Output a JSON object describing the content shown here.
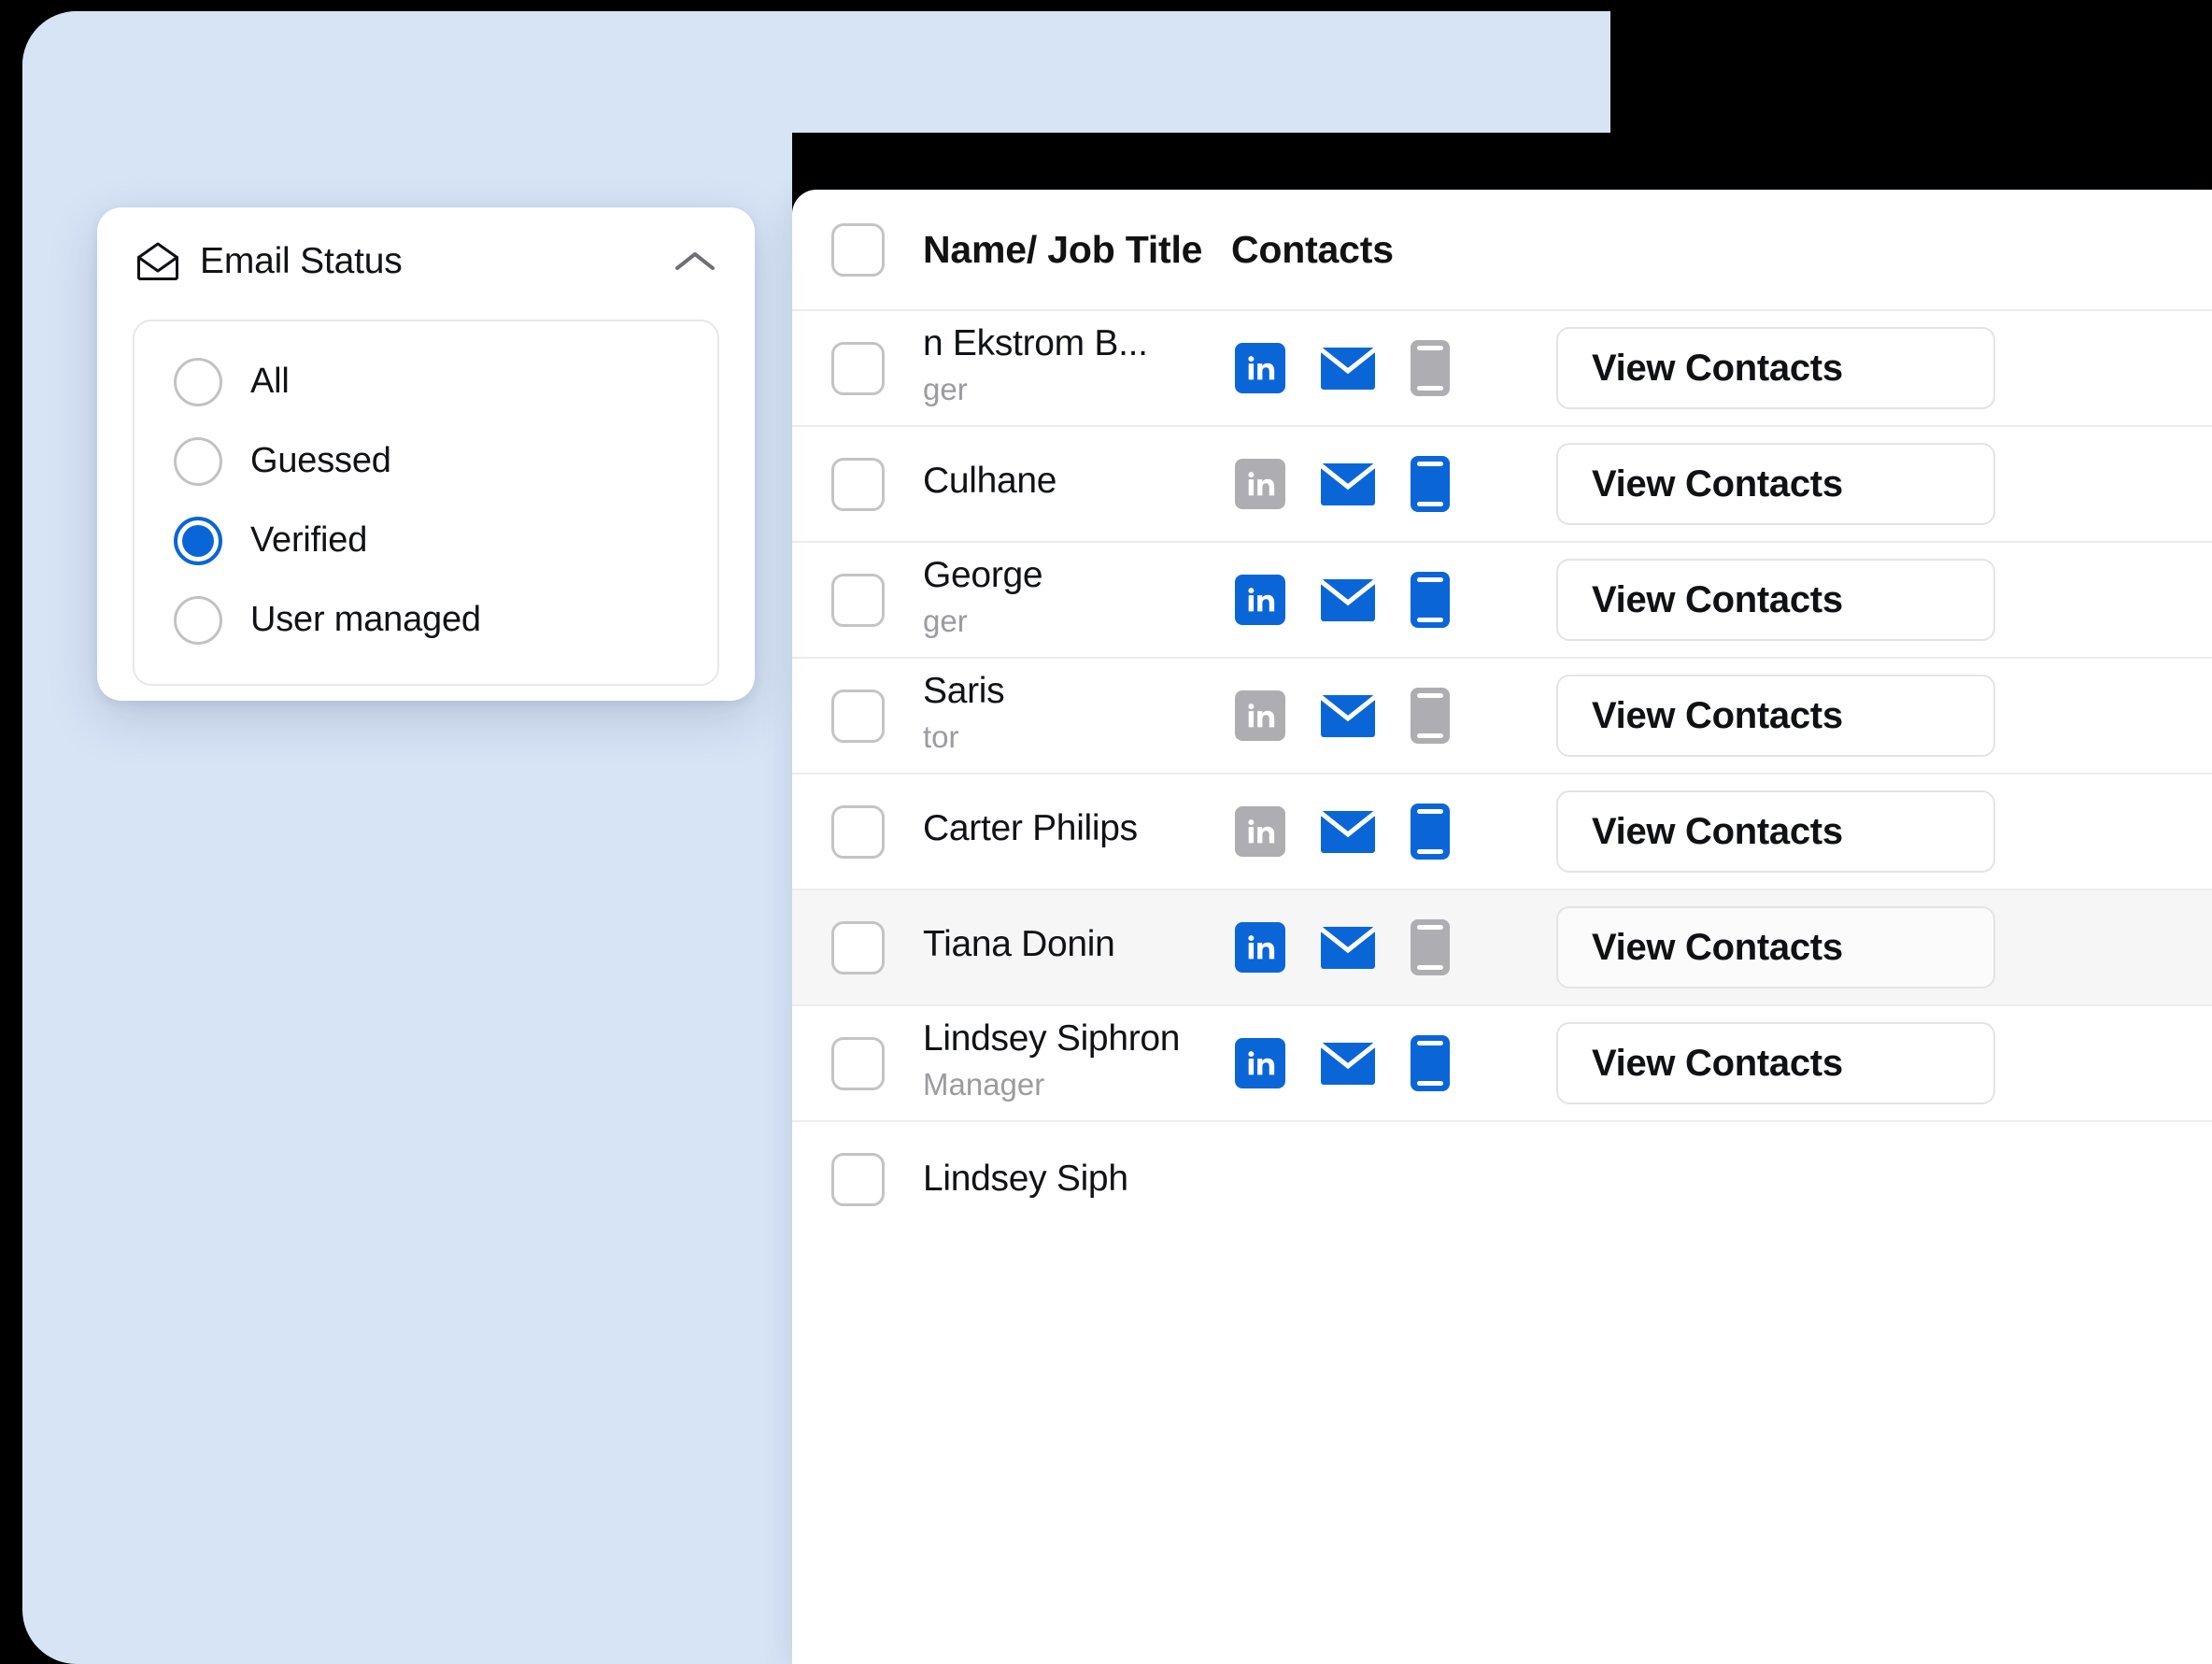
{
  "theme": {
    "backdrop": "#d7e4f6",
    "accent_blue": "#0a66d6",
    "muted_gray": "#aeaeb2",
    "row_highlight": "#f6f6f7"
  },
  "table": {
    "columns": {
      "select_all": "",
      "name_job_title": "Name/ Job Title",
      "contacts": "Contacts"
    },
    "rows": [
      {
        "name": "n Ekstrom B...",
        "job_title": "ger",
        "obscured": true,
        "linkedin": "active",
        "email": "active",
        "phone": "inactive",
        "action": "View Contacts",
        "highlighted": false
      },
      {
        "name": "Culhane",
        "job_title": "",
        "obscured": true,
        "linkedin": "inactive",
        "email": "active",
        "phone": "active",
        "action": "View Contacts",
        "highlighted": false
      },
      {
        "name": "George",
        "job_title": "ger",
        "obscured": true,
        "linkedin": "active",
        "email": "active",
        "phone": "active",
        "action": "View Contacts",
        "highlighted": false
      },
      {
        "name": "Saris",
        "job_title": "tor",
        "obscured": true,
        "linkedin": "inactive",
        "email": "active",
        "phone": "inactive",
        "action": "View Contacts",
        "highlighted": false
      },
      {
        "name": "Carter Philips",
        "job_title": "",
        "obscured": false,
        "linkedin": "inactive",
        "email": "active",
        "phone": "active",
        "action": "View Contacts",
        "highlighted": false
      },
      {
        "name": "Tiana Donin",
        "job_title": "",
        "obscured": false,
        "linkedin": "active",
        "email": "active",
        "phone": "inactive",
        "action": "View Contacts",
        "highlighted": true
      },
      {
        "name": "Lindsey Siphron",
        "job_title": "Manager",
        "obscured": false,
        "linkedin": "active",
        "email": "active",
        "phone": "active",
        "action": "View Contacts",
        "highlighted": false
      },
      {
        "name": "Lindsey Siph",
        "job_title": "",
        "obscured": false,
        "linkedin": "",
        "email": "",
        "phone": "",
        "action": "",
        "highlighted": false
      }
    ]
  },
  "popover": {
    "icon": "open-envelope-icon",
    "title": "Email Status",
    "collapse_icon": "chevron-up-icon",
    "selected": "Verified",
    "options": [
      {
        "label": "All",
        "selected": false
      },
      {
        "label": "Guessed",
        "selected": false
      },
      {
        "label": "Verified",
        "selected": true
      },
      {
        "label": "User managed",
        "selected": false
      }
    ]
  }
}
